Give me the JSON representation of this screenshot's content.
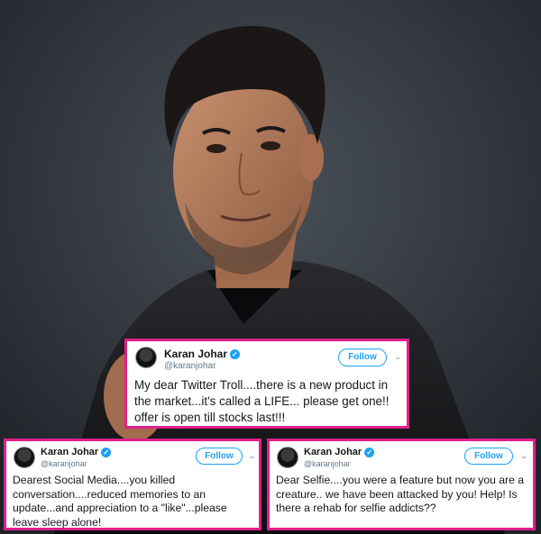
{
  "tweets": [
    {
      "author": "Karan Johar",
      "handle": "@karanjohar",
      "follow_label": "Follow",
      "text": "My dear Twitter Troll....there is a new product in the market...it's called a LIFE... please get one!! offer is open till stocks last!!!"
    },
    {
      "author": "Karan Johar",
      "handle": "@karanjohar",
      "follow_label": "Follow",
      "text": "Dearest Social Media....you killed conversation....reduced memories to an update...and appreciation to a \"like\"...please leave sleep alone!"
    },
    {
      "author": "Karan Johar",
      "handle": "@karanjohar",
      "follow_label": "Follow",
      "text": "Dear Selfie....you were a feature but now you are a creature.. we have been attacked by you! Help! Is there a rehab for selfie addicts??"
    }
  ],
  "colors": {
    "frame": "#e0208a",
    "verified": "#1da1f2",
    "background": "#2c3138"
  },
  "icons": {
    "verified": "verified-badge-icon",
    "chevron": "chevron-down-icon"
  }
}
